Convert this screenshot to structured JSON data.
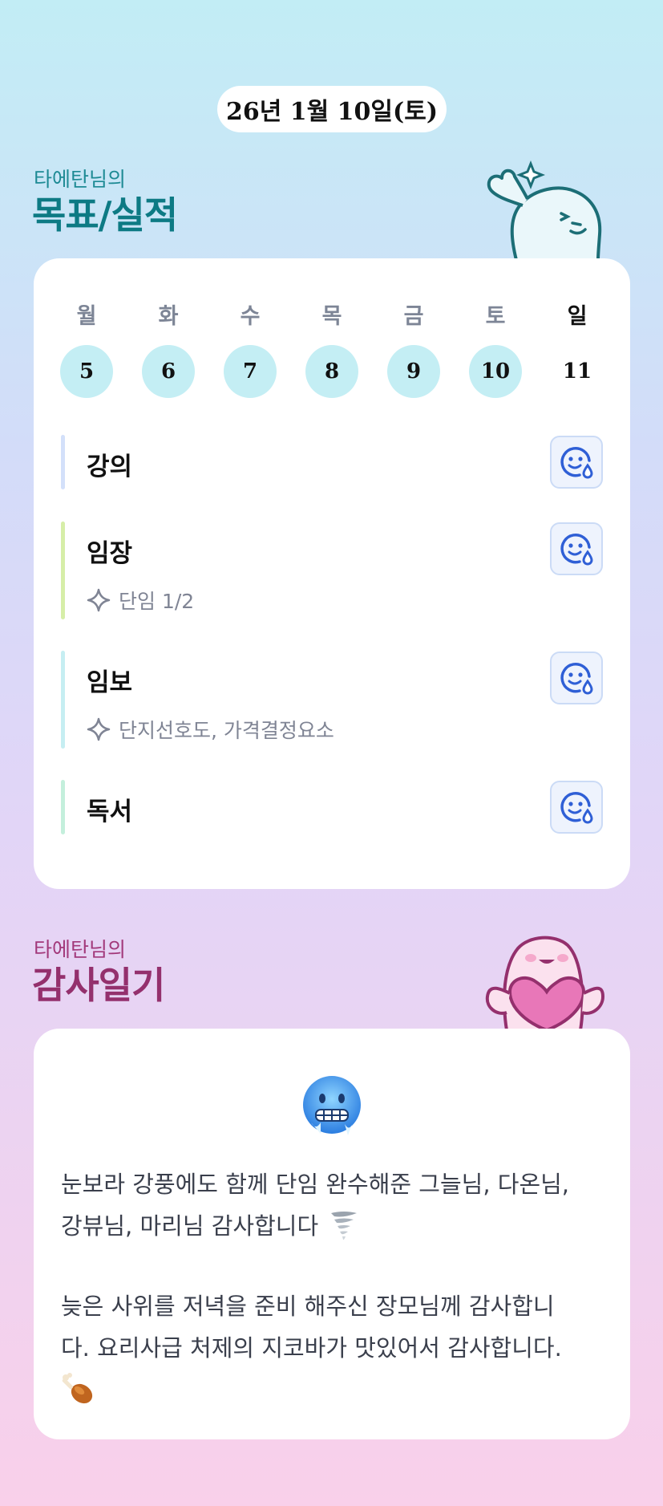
{
  "header": {
    "date": "26년 1월 10일(토)"
  },
  "goals_section": {
    "subtitle": "타에탄님의",
    "title": "목표/실적",
    "weekdays": [
      "월",
      "화",
      "수",
      "목",
      "금",
      "토",
      "일"
    ],
    "days": [
      "5",
      "6",
      "7",
      "8",
      "9",
      "10",
      "11"
    ],
    "tasks": [
      {
        "name": "강의",
        "note": "",
        "bar_color": "#d3e0fa"
      },
      {
        "name": "임장",
        "note": "단임 1/2",
        "bar_color": "#d6eea8"
      },
      {
        "name": "임보",
        "note": "단지선호도, 가격결정요소",
        "bar_color": "#c6eef2"
      },
      {
        "name": "독서",
        "note": "",
        "bar_color": "#c4efdc"
      }
    ],
    "button_icon": "smile-sweat-icon"
  },
  "gratitude_section": {
    "subtitle": "타에탄님의",
    "title": "감사일기",
    "emoji": "cold-face-emoji",
    "paragraph1_line1": "눈보라 강풍에도 함께 단임 완수해준 그늘님, 다온님,",
    "paragraph1_line2": "강뷰님, 마리님 감사합니다",
    "paragraph2_line1": "늦은 사위를 저녁을 준비 해주신 장모님께 감사합니",
    "paragraph2_line2": "다. 요리사급 처제의 지코바가 맛있어서 감사합니다.",
    "tornado_icon": "tornado-icon",
    "drumstick_icon": "poultry-leg-icon"
  },
  "colors": {
    "goal_title": "#0d7a84",
    "gratitude_title": "#94306d",
    "day_circle": "#c4eef4",
    "action_button_bg": "#eef3fd"
  }
}
